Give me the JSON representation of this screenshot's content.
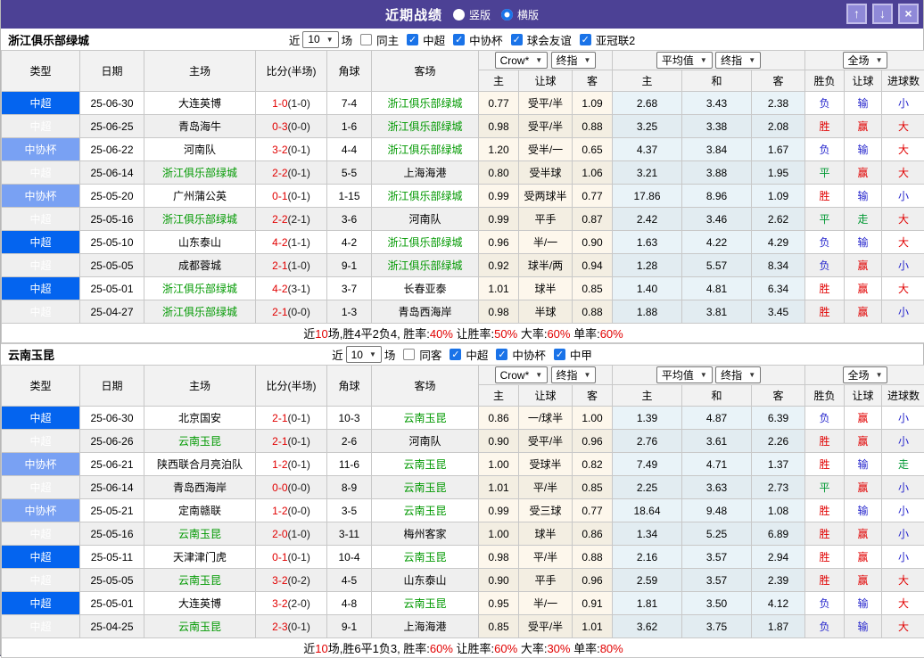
{
  "title_bar": {
    "title": "近期战绩",
    "radio_vertical": "竖版",
    "radio_horizontal": "横版",
    "selected_layout": "横版",
    "buttons": [
      {
        "name": "move-up-button",
        "icon": "up-arrow-icon",
        "glyph": "↑"
      },
      {
        "name": "move-down-button",
        "icon": "down-arrow-icon",
        "glyph": "↓"
      },
      {
        "name": "close-button",
        "icon": "close-icon",
        "glyph": "×"
      }
    ]
  },
  "colors": {
    "titlebar_purple": "#4c4195",
    "league_csl_blue": "#0464ef",
    "league_cup_blue": "#79a1f3",
    "focus_team_green": "#009900",
    "win_red": "#e10000",
    "lose_blue": "#2626cd",
    "draw_green": "#009933",
    "checkbox_blue": "#1a73e8"
  },
  "columns": {
    "left": [
      "类型",
      "日期",
      "主场",
      "比分(半场)",
      "角球",
      "客场"
    ],
    "subs": [
      "主",
      "让球",
      "客",
      "主",
      "和",
      "客",
      "胜负",
      "让球",
      "进球数"
    ],
    "select_groups": [
      [
        "Crow*",
        "终指"
      ],
      [
        "平均值",
        "终指"
      ],
      [
        "全场"
      ]
    ]
  },
  "result_color_map": {
    "胜": "r",
    "赢": "r",
    "大": "r",
    "负": "b",
    "输": "b",
    "小": "b",
    "平": "g",
    "走": "g"
  },
  "sections": [
    {
      "team": "浙江俱乐部绿城",
      "filter": {
        "near_label": "近",
        "count": "10",
        "games_label": "场",
        "checks": [
          [
            "同主",
            false
          ],
          [
            "中超",
            true
          ],
          [
            "中协杯",
            true
          ],
          [
            "球会友谊",
            true
          ],
          [
            "亚冠联2",
            true
          ]
        ]
      },
      "rows": [
        [
          "中超",
          "25-06-30",
          "大连英博",
          0,
          "1-0",
          "(1-0)",
          "7-4",
          "浙江俱乐部绿城",
          1,
          "0.77",
          "受平/半",
          "1.09",
          "2.68",
          "3.43",
          "2.38",
          "负",
          "输",
          "小"
        ],
        [
          "中超",
          "25-06-25",
          "青岛海牛",
          0,
          "0-3",
          "(0-0)",
          "1-6",
          "浙江俱乐部绿城",
          1,
          "0.98",
          "受平/半",
          "0.88",
          "3.25",
          "3.38",
          "2.08",
          "胜",
          "赢",
          "大"
        ],
        [
          "中协杯",
          "25-06-22",
          "河南队",
          0,
          "3-2",
          "(0-1)",
          "4-4",
          "浙江俱乐部绿城",
          1,
          "1.20",
          "受半/一",
          "0.65",
          "4.37",
          "3.84",
          "1.67",
          "负",
          "输",
          "大"
        ],
        [
          "中超",
          "25-06-14",
          "浙江俱乐部绿城",
          1,
          "2-2",
          "(0-1)",
          "5-5",
          "上海海港",
          0,
          "0.80",
          "受半球",
          "1.06",
          "3.21",
          "3.88",
          "1.95",
          "平",
          "赢",
          "大"
        ],
        [
          "中协杯",
          "25-05-20",
          "广州蒲公英",
          0,
          "0-1",
          "(0-1)",
          "1-15",
          "浙江俱乐部绿城",
          1,
          "0.99",
          "受两球半",
          "0.77",
          "17.86",
          "8.96",
          "1.09",
          "胜",
          "输",
          "小"
        ],
        [
          "中超",
          "25-05-16",
          "浙江俱乐部绿城",
          1,
          "2-2",
          "(2-1)",
          "3-6",
          "河南队",
          0,
          "0.99",
          "平手",
          "0.87",
          "2.42",
          "3.46",
          "2.62",
          "平",
          "走",
          "大"
        ],
        [
          "中超",
          "25-05-10",
          "山东泰山",
          0,
          "4-2",
          "(1-1)",
          "4-2",
          "浙江俱乐部绿城",
          1,
          "0.96",
          "半/一",
          "0.90",
          "1.63",
          "4.22",
          "4.29",
          "负",
          "输",
          "大"
        ],
        [
          "中超",
          "25-05-05",
          "成都蓉城",
          0,
          "2-1",
          "(1-0)",
          "9-1",
          "浙江俱乐部绿城",
          1,
          "0.92",
          "球半/两",
          "0.94",
          "1.28",
          "5.57",
          "8.34",
          "负",
          "赢",
          "小"
        ],
        [
          "中超",
          "25-05-01",
          "浙江俱乐部绿城",
          1,
          "4-2",
          "(3-1)",
          "3-7",
          "长春亚泰",
          0,
          "1.01",
          "球半",
          "0.85",
          "1.40",
          "4.81",
          "6.34",
          "胜",
          "赢",
          "大"
        ],
        [
          "中超",
          "25-04-27",
          "浙江俱乐部绿城",
          1,
          "2-1",
          "(0-0)",
          "1-3",
          "青岛西海岸",
          0,
          "0.98",
          "半球",
          "0.88",
          "1.88",
          "3.81",
          "3.45",
          "胜",
          "赢",
          "小"
        ]
      ],
      "summary": [
        [
          "近",
          0
        ],
        [
          "10",
          1
        ],
        [
          "场,胜4平2负4, 胜率:",
          0
        ],
        [
          "40%",
          1
        ],
        [
          " 让胜率:",
          0
        ],
        [
          "50%",
          1
        ],
        [
          " 大率:",
          0
        ],
        [
          "60%",
          1
        ],
        [
          " 单率:",
          0
        ],
        [
          "60%",
          1
        ]
      ]
    },
    {
      "team": "云南玉昆",
      "filter": {
        "near_label": "近",
        "count": "10",
        "games_label": "场",
        "checks": [
          [
            "同客",
            false
          ],
          [
            "中超",
            true
          ],
          [
            "中协杯",
            true
          ],
          [
            "中甲",
            true
          ]
        ]
      },
      "rows": [
        [
          "中超",
          "25-06-30",
          "北京国安",
          0,
          "2-1",
          "(0-1)",
          "10-3",
          "云南玉昆",
          1,
          "0.86",
          "一/球半",
          "1.00",
          "1.39",
          "4.87",
          "6.39",
          "负",
          "赢",
          "小"
        ],
        [
          "中超",
          "25-06-26",
          "云南玉昆",
          1,
          "2-1",
          "(0-1)",
          "2-6",
          "河南队",
          0,
          "0.90",
          "受平/半",
          "0.96",
          "2.76",
          "3.61",
          "2.26",
          "胜",
          "赢",
          "小"
        ],
        [
          "中协杯",
          "25-06-21",
          "陕西联合月亮泊队",
          0,
          "1-2",
          "(0-1)",
          "11-6",
          "云南玉昆",
          1,
          "1.00",
          "受球半",
          "0.82",
          "7.49",
          "4.71",
          "1.37",
          "胜",
          "输",
          "走"
        ],
        [
          "中超",
          "25-06-14",
          "青岛西海岸",
          0,
          "0-0",
          "(0-0)",
          "8-9",
          "云南玉昆",
          1,
          "1.01",
          "平/半",
          "0.85",
          "2.25",
          "3.63",
          "2.73",
          "平",
          "赢",
          "小"
        ],
        [
          "中协杯",
          "25-05-21",
          "定南赣联",
          0,
          "1-2",
          "(0-0)",
          "3-5",
          "云南玉昆",
          1,
          "0.99",
          "受三球",
          "0.77",
          "18.64",
          "9.48",
          "1.08",
          "胜",
          "输",
          "小"
        ],
        [
          "中超",
          "25-05-16",
          "云南玉昆",
          1,
          "2-0",
          "(1-0)",
          "3-11",
          "梅州客家",
          0,
          "1.00",
          "球半",
          "0.86",
          "1.34",
          "5.25",
          "6.89",
          "胜",
          "赢",
          "小"
        ],
        [
          "中超",
          "25-05-11",
          "天津津门虎",
          0,
          "0-1",
          "(0-1)",
          "10-4",
          "云南玉昆",
          1,
          "0.98",
          "平/半",
          "0.88",
          "2.16",
          "3.57",
          "2.94",
          "胜",
          "赢",
          "小"
        ],
        [
          "中超",
          "25-05-05",
          "云南玉昆",
          1,
          "3-2",
          "(0-2)",
          "4-5",
          "山东泰山",
          0,
          "0.90",
          "平手",
          "0.96",
          "2.59",
          "3.57",
          "2.39",
          "胜",
          "赢",
          "大"
        ],
        [
          "中超",
          "25-05-01",
          "大连英博",
          0,
          "3-2",
          "(2-0)",
          "4-8",
          "云南玉昆",
          1,
          "0.95",
          "半/一",
          "0.91",
          "1.81",
          "3.50",
          "4.12",
          "负",
          "输",
          "大"
        ],
        [
          "中超",
          "25-04-25",
          "云南玉昆",
          1,
          "2-3",
          "(0-1)",
          "9-1",
          "上海海港",
          0,
          "0.85",
          "受平/半",
          "1.01",
          "3.62",
          "3.75",
          "1.87",
          "负",
          "输",
          "大"
        ]
      ],
      "summary": [
        [
          "近",
          0
        ],
        [
          "10",
          1
        ],
        [
          "场,胜6平1负3, 胜率:",
          0
        ],
        [
          "60%",
          1
        ],
        [
          " 让胜率:",
          0
        ],
        [
          "60%",
          1
        ],
        [
          " 大率:",
          0
        ],
        [
          "30%",
          1
        ],
        [
          " 单率:",
          0
        ],
        [
          "80%",
          1
        ]
      ]
    }
  ]
}
